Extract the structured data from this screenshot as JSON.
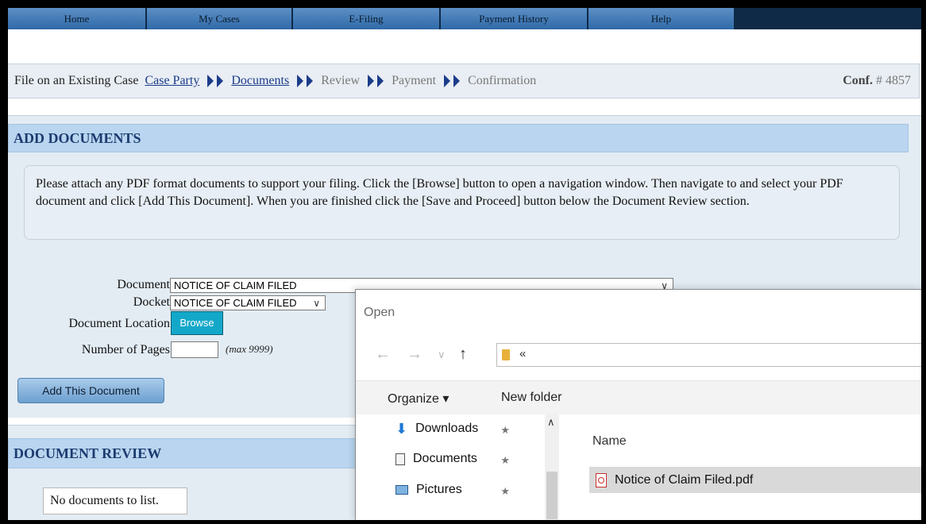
{
  "nav": {
    "tabs": [
      {
        "label": "Home"
      },
      {
        "label": "My Cases"
      },
      {
        "label": "E-Filing"
      },
      {
        "label": "Payment History"
      },
      {
        "label": "Help"
      }
    ]
  },
  "breadcrumb": {
    "prefix": "File on an Existing Case",
    "steps": [
      {
        "label": "Case Party",
        "state": "link"
      },
      {
        "label": "Documents",
        "state": "link"
      },
      {
        "label": "Review",
        "state": "disabled"
      },
      {
        "label": "Payment",
        "state": "disabled"
      },
      {
        "label": "Confirmation",
        "state": "disabled"
      }
    ],
    "conf_label": "Conf.",
    "conf_number": "# 4857"
  },
  "add_documents": {
    "heading": "ADD DOCUMENTS",
    "instructions": "Please attach any PDF format documents to support your filing. Click the [Browse] button to open a navigation window. Then navigate to and select your PDF document and click [Add This Document]. When you are finished click the [Save and Proceed] button below the Document Review section.",
    "document_label": "Document",
    "document_value": "NOTICE OF CLAIM FILED",
    "docket_label": "Docket",
    "docket_value": "NOTICE OF CLAIM FILED",
    "location_label": "Document Location",
    "browse_label": "Browse",
    "pages_label": "Number of Pages",
    "pages_value": "",
    "pages_hint": "(max 9999)",
    "add_button": "Add This Document"
  },
  "document_review": {
    "heading": "DOCUMENT REVIEW",
    "empty_text": "No documents to list."
  },
  "open_dialog": {
    "title": "Open",
    "address": "«",
    "organize": "Organize ▾",
    "new_folder": "New folder",
    "nav_items": [
      {
        "label": "Downloads",
        "icon": "download-icon"
      },
      {
        "label": "Documents",
        "icon": "documents-icon"
      },
      {
        "label": "Pictures",
        "icon": "pictures-icon"
      }
    ],
    "column_name": "Name",
    "files": [
      {
        "name": "Notice of Claim Filed.pdf",
        "icon": "pdf-icon"
      }
    ]
  }
}
